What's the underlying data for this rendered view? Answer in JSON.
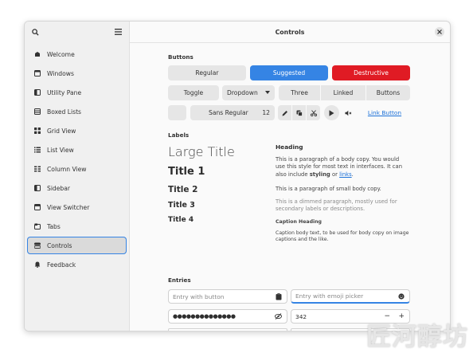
{
  "window_title": "Controls",
  "sidebar": {
    "items": [
      {
        "label": "Welcome",
        "icon": "welcome-icon"
      },
      {
        "label": "Windows",
        "icon": "windows-icon"
      },
      {
        "label": "Utility Pane",
        "icon": "utility-pane-icon"
      },
      {
        "label": "Boxed Lists",
        "icon": "boxed-lists-icon"
      },
      {
        "label": "Grid View",
        "icon": "grid-view-icon"
      },
      {
        "label": "List View",
        "icon": "list-view-icon"
      },
      {
        "label": "Column View",
        "icon": "column-view-icon"
      },
      {
        "label": "Sidebar",
        "icon": "sidebar-icon"
      },
      {
        "label": "View Switcher",
        "icon": "view-switcher-icon"
      },
      {
        "label": "Tabs",
        "icon": "tabs-icon"
      },
      {
        "label": "Controls",
        "icon": "controls-icon",
        "active": true
      },
      {
        "label": "Feedback",
        "icon": "feedback-icon"
      }
    ]
  },
  "buttons": {
    "heading": "Buttons",
    "regular": "Regular",
    "suggested": "Suggested",
    "destructive": "Destructive",
    "toggle": "Toggle",
    "dropdown": "Dropdown",
    "three": "Three",
    "linked": "Linked",
    "buttons": "Buttons",
    "font_name": "Sans Regular",
    "font_size": "12",
    "link_button": "Link Button"
  },
  "labels": {
    "heading": "Labels",
    "large_title": "Large Title",
    "title1": "Title 1",
    "title2": "Title 2",
    "title3": "Title 3",
    "title4": "Title 4",
    "body_heading": "Heading",
    "body_pre": "This is a paragraph of a body copy. You would use this style for most text in interfaces. It can also include ",
    "body_styling": "styling",
    "body_or": " or ",
    "body_links": "links",
    "body_end": ".",
    "small_copy": "This is a paragraph of small body copy.",
    "dimmed": "This is a dimmed paragraph, mostly used for secondary labels or descriptions.",
    "caption_heading": "Caption Heading",
    "caption": "Caption body text, to be used for body copy on image captions and the like."
  },
  "entries": {
    "heading": "Entries",
    "entry_button_placeholder": "Entry with button",
    "emoji_placeholder": "Entry with emoji picker",
    "password": "●●●●●●●●●●●●●●",
    "spin_value": "342",
    "minus": "−",
    "plus": "+"
  },
  "watermark": "匠河醇坊",
  "colors": {
    "accent": "#3584e4",
    "destructive": "#e01b24",
    "link": "#1c71d8"
  }
}
